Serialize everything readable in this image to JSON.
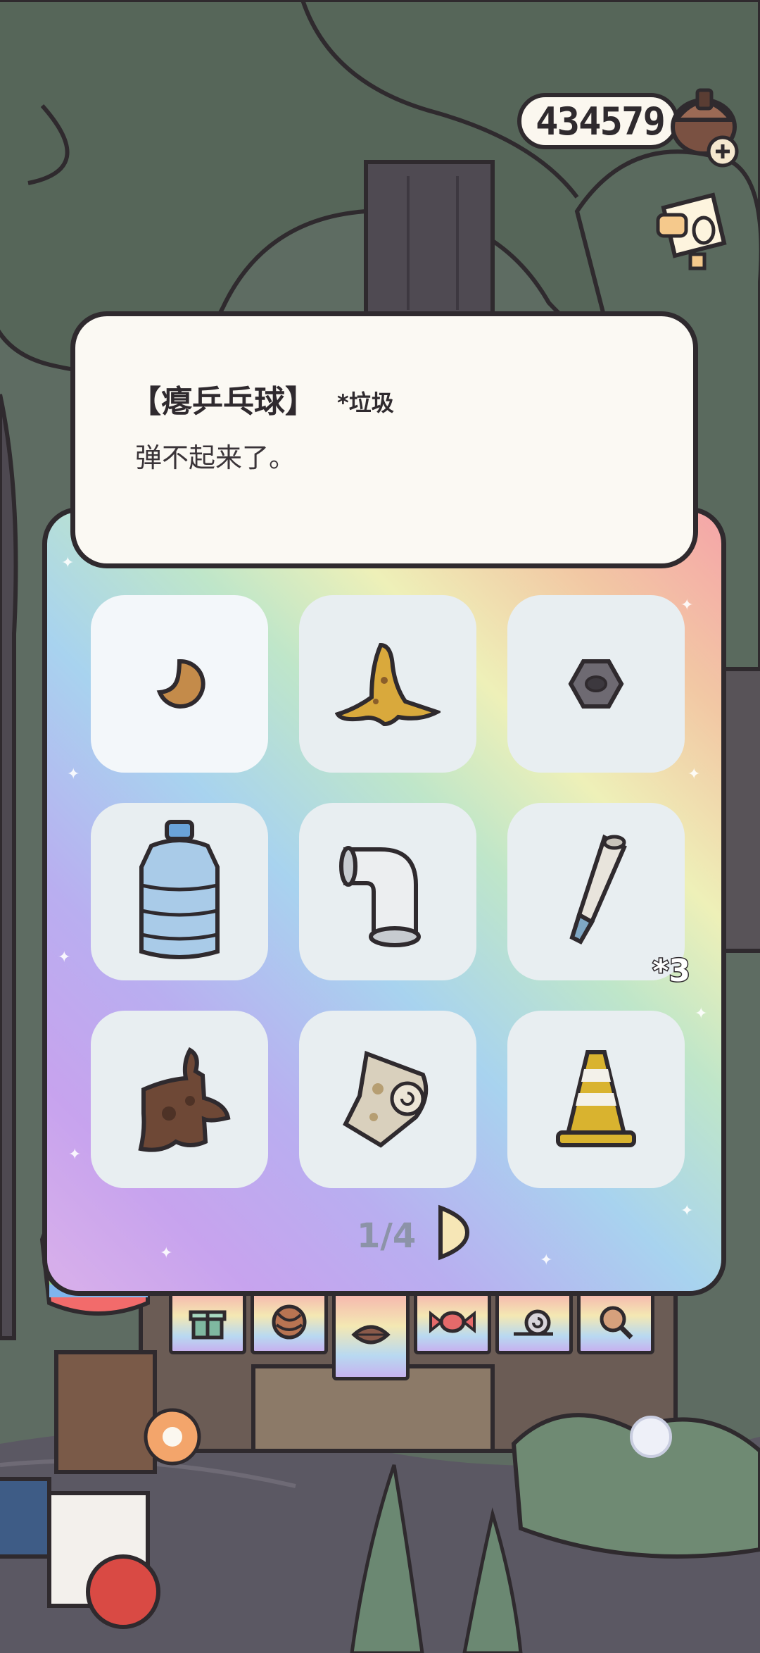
{
  "currency": {
    "value": "434579",
    "icon": "acorn-icon",
    "add_icon": "plus-icon"
  },
  "item": {
    "title": "【瘪乒乓球】",
    "tag": "*垃圾",
    "description": "弹不起来了。"
  },
  "grid": {
    "slots": [
      {
        "name": "deflated-ping-pong-ball",
        "icon": "ping-pong-ball-icon",
        "selected": true
      },
      {
        "name": "banana-peel",
        "icon": "banana-peel-icon"
      },
      {
        "name": "hex-nut",
        "icon": "hex-nut-icon"
      },
      {
        "name": "water-jug",
        "icon": "water-jug-icon"
      },
      {
        "name": "pipe-elbow",
        "icon": "pipe-elbow-icon"
      },
      {
        "name": "broken-pen",
        "icon": "broken-pen-icon",
        "count": "*3"
      },
      {
        "name": "tree-stump",
        "icon": "tree-stump-icon"
      },
      {
        "name": "paper-roll",
        "icon": "paper-roll-icon"
      },
      {
        "name": "traffic-cone",
        "icon": "traffic-cone-icon"
      }
    ]
  },
  "pager": {
    "label": "1/4"
  },
  "tabs": [
    {
      "name": "gift",
      "icon": "gift-icon"
    },
    {
      "name": "yarn",
      "icon": "yarn-ball-icon"
    },
    {
      "name": "leaf",
      "icon": "leaf-icon",
      "active": true
    },
    {
      "name": "candy",
      "icon": "candy-icon"
    },
    {
      "name": "snail",
      "icon": "snail-icon"
    },
    {
      "name": "magnifier",
      "icon": "magnifier-icon"
    }
  ]
}
